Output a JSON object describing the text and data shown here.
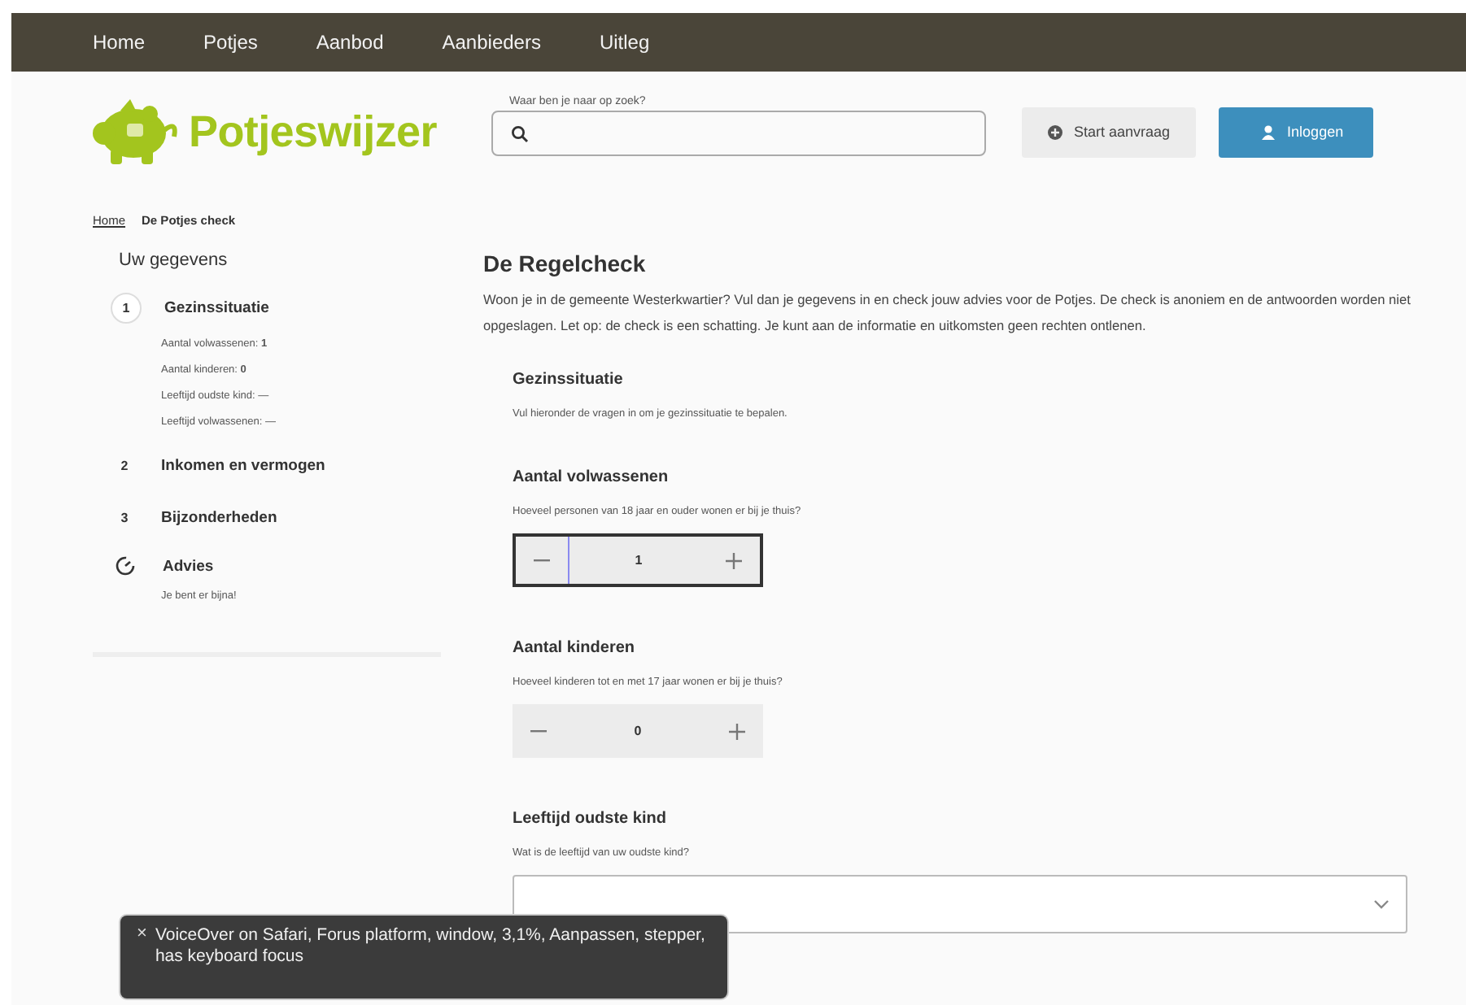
{
  "nav": [
    {
      "label": "Home"
    },
    {
      "label": "Potjes"
    },
    {
      "label": "Aanbod"
    },
    {
      "label": "Aanbieders"
    },
    {
      "label": "Uitleg"
    }
  ],
  "logo": {
    "text": "Potjeswijzer"
  },
  "search": {
    "label": "Waar ben je naar op zoek?"
  },
  "buttons": [
    {
      "kind": "secondary",
      "label": "Start aanvraag"
    },
    {
      "kind": "primary",
      "label": "Inloggen"
    }
  ],
  "breadcrumb": [
    {
      "label": "Home",
      "link": true
    },
    {
      "label": "De Potjes check",
      "link": false
    }
  ],
  "sidebar": {
    "title": "Uw gegevens",
    "steps": [
      {
        "kind": "number",
        "number": "1",
        "label": "Gezinssituatie",
        "active": true,
        "details": [
          "Aantal volwassenen: **1**",
          "Aantal kinderen: **0**",
          "Leeftijd oudste kind: —",
          "Leeftijd volwassenen: —"
        ]
      },
      {
        "kind": "number",
        "number": "2",
        "label": "Inkomen en vermogen",
        "active": false
      },
      {
        "kind": "number",
        "number": "3",
        "label": "Bijzonderheden",
        "active": false
      },
      {
        "kind": "icon",
        "label": "Advies",
        "active": false,
        "details": [
          "Je bent er bijna!"
        ]
      }
    ]
  },
  "main": {
    "title": "De Regelcheck",
    "intro": "Woon je in de gemeente Westerkwartier? Vul dan je gegevens in en check jouw advies voor de Potjes. De check is anoniem en de antwoorden worden niet opgeslagen. Let op: de check is een schatting. Je kunt aan de informatie en uitkomsten geen rechten ontlenen.",
    "section": {
      "title": "Gezinssituatie",
      "text": "Vul hieronder de vragen in om je gezinssituatie te bepalen."
    },
    "questions": [
      {
        "kind": "stepper",
        "title": "Aantal volwassenen",
        "hint": "Hoeveel personen van 18 jaar en ouder wonen er bij je thuis?",
        "value": "1",
        "focused": true
      },
      {
        "kind": "stepper",
        "title": "Aantal kinderen",
        "hint": "Hoeveel kinderen tot en met 17 jaar wonen er bij je thuis?",
        "value": "0",
        "focused": false
      },
      {
        "kind": "select",
        "title": "Leeftijd oudste kind",
        "hint": "Wat is de leeftijd van uw oudste kind?"
      }
    ]
  },
  "toast": {
    "close": "×",
    "text": "VoiceOver on Safari, Forus platform, window, 3,1%, Aanpassen, stepper, has keyboard focus"
  }
}
